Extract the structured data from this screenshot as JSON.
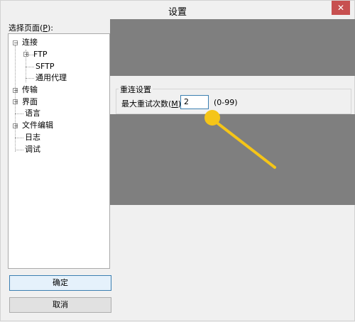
{
  "window": {
    "title": "设置",
    "close_glyph": "✕"
  },
  "left_panel": {
    "label_prefix": "选择页面(",
    "label_key": "P",
    "label_suffix": "):",
    "tree": [
      {
        "label": "连接",
        "expanded": true
      },
      {
        "label": "FTP",
        "expanded": false
      },
      {
        "label": "SFTP"
      },
      {
        "label": "通用代理"
      },
      {
        "label": "传输",
        "expanded": false
      },
      {
        "label": "界面",
        "expanded": false
      },
      {
        "label": "语言"
      },
      {
        "label": "文件编辑",
        "expanded": false
      },
      {
        "label": "日志"
      },
      {
        "label": "调试"
      }
    ]
  },
  "buttons": {
    "ok": "确定",
    "cancel": "取消"
  },
  "reconnect": {
    "group_title": "重连设置",
    "label_prefix": "最大重试次数(",
    "label_key": "M",
    "label_suffix": "):",
    "value": "2",
    "hint": "(0-99)"
  },
  "colors": {
    "pointer": "#f5c518",
    "mask": "#7f7f7f",
    "close": "#c75050"
  }
}
